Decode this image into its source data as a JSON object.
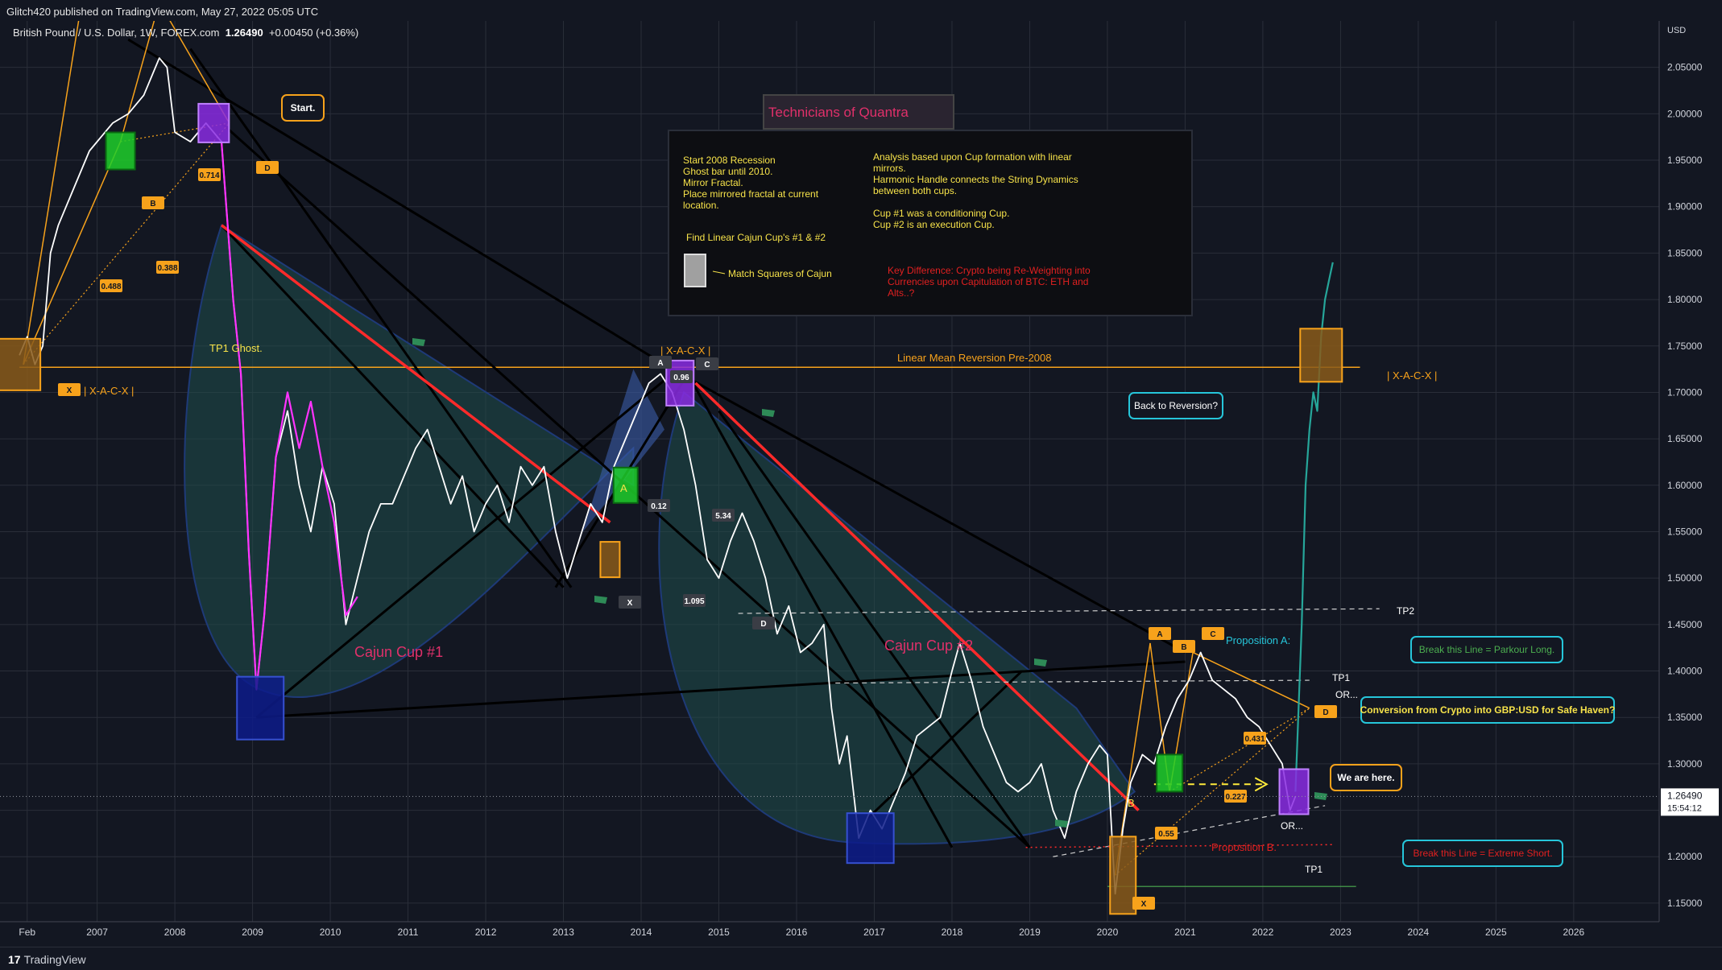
{
  "header": {
    "published": "Glitch420 published on TradingView.com, May 27, 2022 05:05 UTC",
    "symbol": "British Pound / U.S. Dollar, 1W, FOREX.com",
    "price": "1.26490",
    "change": "+0.00450 (+0.36%)",
    "currency": "USD",
    "last_price": "1.26490",
    "countdown": "15:54:12"
  },
  "footer": {
    "brand": "TradingView"
  },
  "chart_data": {
    "type": "line",
    "title": "",
    "xlabel": "",
    "ylabel": "",
    "x_ticks": [
      "Feb",
      "2007",
      "2008",
      "2009",
      "2010",
      "2011",
      "2012",
      "2013",
      "2014",
      "2015",
      "2016",
      "2017",
      "2018",
      "2019",
      "2020",
      "2021",
      "2022",
      "2023",
      "2024",
      "2025",
      "2026"
    ],
    "y_ticks": [
      "2.05000",
      "2.00000",
      "1.95000",
      "1.90000",
      "1.85000",
      "1.80000",
      "1.75000",
      "1.70000",
      "1.65000",
      "1.60000",
      "1.55000",
      "1.50000",
      "1.45000",
      "1.40000",
      "1.35000",
      "1.30000",
      "1.25000",
      "1.20000",
      "1.15000"
    ],
    "ylim": [
      1.13,
      2.1
    ],
    "xlim": [
      2005.75,
      2027.1
    ],
    "grid": true,
    "series": [
      {
        "color": "#ffffff",
        "x": [
          2006.0,
          2006.1,
          2006.2,
          2006.3,
          2006.4,
          2006.5,
          2006.7,
          2006.9,
          2007.0,
          2007.2,
          2007.4,
          2007.6,
          2007.8,
          2007.9,
          2008.0,
          2008.2,
          2008.4,
          2008.6,
          2008.75,
          2008.85,
          2008.95,
          2009.05,
          2009.15,
          2009.3,
          2009.45,
          2009.6,
          2009.75,
          2009.9,
          2010.05,
          2010.2,
          2010.35,
          2010.5,
          2010.65,
          2010.8,
          2010.95,
          2011.1,
          2011.25,
          2011.4,
          2011.55,
          2011.7,
          2011.85,
          2012.0,
          2012.15,
          2012.3,
          2012.45,
          2012.6,
          2012.75,
          2012.9,
          2013.05,
          2013.2,
          2013.35,
          2013.5,
          2013.65,
          2013.8,
          2013.95,
          2014.1,
          2014.25,
          2014.4,
          2014.55,
          2014.7,
          2014.85,
          2015.0,
          2015.15,
          2015.3,
          2015.45,
          2015.6,
          2015.75,
          2015.9,
          2016.05,
          2016.2,
          2016.35,
          2016.45,
          2016.55,
          2016.65,
          2016.8,
          2016.95,
          2017.1,
          2017.25,
          2017.4,
          2017.55,
          2017.7,
          2017.85,
          2018.0,
          2018.1,
          2018.25,
          2018.4,
          2018.55,
          2018.7,
          2018.85,
          2019.0,
          2019.15,
          2019.3,
          2019.45,
          2019.6,
          2019.75,
          2019.9,
          2020.0,
          2020.1,
          2020.2,
          2020.3,
          2020.45,
          2020.6,
          2020.75,
          2020.9,
          2021.05,
          2021.2,
          2021.35,
          2021.5,
          2021.65,
          2021.8,
          2021.95,
          2022.1,
          2022.25,
          2022.35,
          2022.42
        ],
        "y": [
          1.74,
          1.76,
          1.73,
          1.75,
          1.85,
          1.88,
          1.92,
          1.96,
          1.97,
          1.99,
          2.0,
          2.02,
          2.06,
          2.05,
          1.98,
          1.97,
          1.99,
          1.97,
          1.8,
          1.72,
          1.53,
          1.38,
          1.46,
          1.63,
          1.68,
          1.6,
          1.55,
          1.62,
          1.58,
          1.45,
          1.5,
          1.55,
          1.58,
          1.58,
          1.61,
          1.64,
          1.66,
          1.62,
          1.58,
          1.61,
          1.55,
          1.58,
          1.6,
          1.56,
          1.62,
          1.6,
          1.62,
          1.55,
          1.5,
          1.54,
          1.58,
          1.56,
          1.62,
          1.65,
          1.68,
          1.71,
          1.72,
          1.7,
          1.66,
          1.6,
          1.52,
          1.5,
          1.54,
          1.57,
          1.54,
          1.5,
          1.44,
          1.47,
          1.42,
          1.43,
          1.45,
          1.36,
          1.3,
          1.33,
          1.22,
          1.25,
          1.23,
          1.26,
          1.29,
          1.33,
          1.34,
          1.35,
          1.4,
          1.43,
          1.39,
          1.34,
          1.31,
          1.28,
          1.27,
          1.28,
          1.3,
          1.25,
          1.22,
          1.27,
          1.3,
          1.32,
          1.31,
          1.16,
          1.23,
          1.28,
          1.31,
          1.3,
          1.34,
          1.37,
          1.39,
          1.42,
          1.39,
          1.38,
          1.37,
          1.35,
          1.34,
          1.32,
          1.3,
          1.25,
          1.265
        ]
      },
      {
        "color": "#ff33ff",
        "x": [
          2008.6,
          2008.75,
          2008.85,
          2008.95,
          2009.05,
          2009.15,
          2009.3,
          2009.45,
          2009.6,
          2009.75,
          2009.9,
          2010.05,
          2010.2,
          2010.35
        ],
        "y": [
          1.97,
          1.8,
          1.72,
          1.53,
          1.38,
          1.46,
          1.63,
          1.7,
          1.64,
          1.69,
          1.62,
          1.56,
          1.46,
          1.48
        ]
      },
      {
        "color": "#26a69a",
        "x": [
          2022.42,
          2022.5,
          2022.55,
          2022.6,
          2022.65,
          2022.7,
          2022.75,
          2022.8,
          2022.85,
          2022.9
        ],
        "y": [
          1.27,
          1.45,
          1.6,
          1.66,
          1.7,
          1.68,
          1.76,
          1.8,
          1.82,
          1.84
        ]
      }
    ]
  },
  "annotations": {
    "title_box": "Technicians of Quantra",
    "left_note": [
      "Start 2008 Recession",
      "Ghost bar until 2010.",
      "Mirror Fractal.",
      "Place mirrored fractal at current",
      "location."
    ],
    "find_note": "Find Linear Cajun Cup's #1 & #2",
    "match_note": "Match Squares of Cajun",
    "right_note": [
      "Analysis based upon Cup formation with linear",
      "mirrors.",
      "Harmonic Handle connects the String Dynamics",
      "between both cups.",
      "",
      "Cup #1 was a conditioning Cup.",
      "Cup #2 is an execution Cup."
    ],
    "key_note": [
      "Key Difference: Crypto being  Re-Weighting into",
      "Currencies upon Capitulation of BTC: ETH and",
      "Alts..?"
    ],
    "start": "Start.",
    "tp1_ghost": "TP1 Ghost.",
    "xacx": "| X-A-C-X |",
    "linear_mean": "Linear Mean Reversion Pre-2008",
    "back_to_reversion": "Back to Reversion?",
    "cup1": "Cajun Cup #1",
    "cup2": "Cajun Cup #2",
    "proposition_a": "Proposition A:",
    "proposition_b": "Proposition B.",
    "break_parkour": "Break this Line = Parkour Long.",
    "conversion": "Conversion from Crypto into GBP:USD for Safe Haven?",
    "we_are_here": "We are here.",
    "break_short": "Break this Line = Extreme Short.",
    "tp1": "TP1",
    "tp2": "TP2",
    "or": "OR...",
    "fib": [
      "0.714",
      "0.488",
      "0.388",
      "0.96",
      "5.34",
      "1.095",
      "0.12",
      "0.431",
      "0.227",
      "0.55"
    ],
    "points": [
      "X",
      "B",
      "D",
      "A",
      "C",
      "X",
      "D",
      "A",
      "B",
      "C",
      "D",
      "X",
      "A",
      "B"
    ]
  },
  "colors": {
    "background": "#131722",
    "grid": "#2a2e39",
    "price_line": "#ffffff",
    "ghost": "#ff33ff",
    "projection": "#26a69a",
    "orange": "#f7a21b",
    "red_trend": "#ff2a2a",
    "cup_fill": "#1f4f4d",
    "cup_border": "#1e3a78"
  }
}
